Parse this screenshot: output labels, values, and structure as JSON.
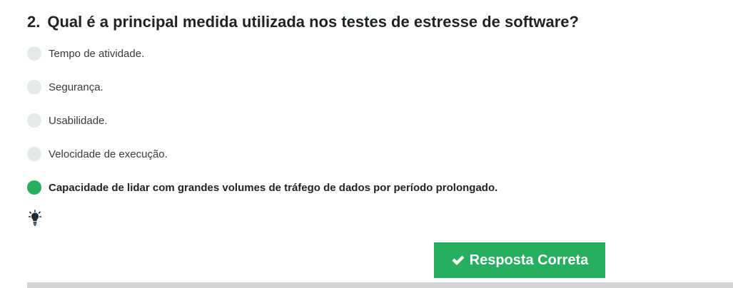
{
  "question": {
    "number": "2.",
    "text": "Qual é a principal medida utilizada nos testes de estresse de software?"
  },
  "options": [
    {
      "label": "Tempo de atividade.",
      "selected": false
    },
    {
      "label": "Segurança.",
      "selected": false
    },
    {
      "label": "Usabilidade.",
      "selected": false
    },
    {
      "label": "Velocidade de execução.",
      "selected": false
    },
    {
      "label": "Capacidade de lidar com grandes volumes de tráfego de dados por período prolongado.",
      "selected": true
    }
  ],
  "hint": {
    "icon": "lightbulb-icon"
  },
  "answer_button": {
    "label": "Resposta Correta",
    "icon": "check-icon"
  },
  "colors": {
    "accent": "#27ae60",
    "radio_unselected": "#e6e9ea",
    "divider": "#d4d4d4"
  }
}
